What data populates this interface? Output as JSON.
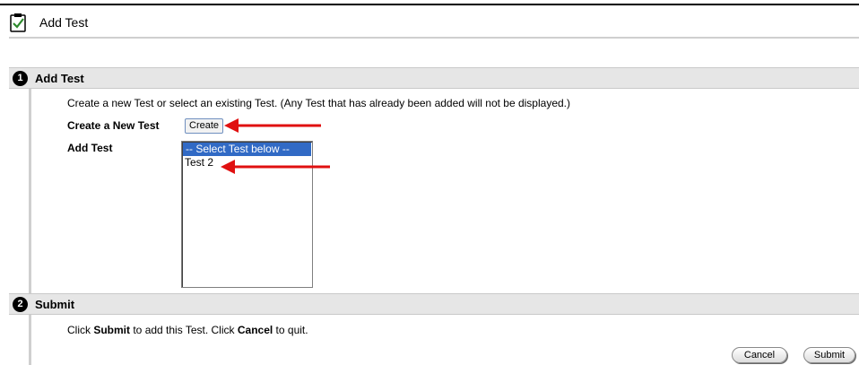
{
  "page": {
    "title": "Add Test",
    "icon": "clipboard-check-icon"
  },
  "section1": {
    "step": "1",
    "title": "Add Test",
    "intro": "Create a new Test or select an existing Test. (Any Test that has already been added will not be displayed.)",
    "create_label": "Create a New Test",
    "create_button": "Create",
    "add_label": "Add Test",
    "options": [
      "-- Select Test below --",
      "Test 2"
    ],
    "selected_option": "-- Select Test below --"
  },
  "section2": {
    "step": "2",
    "title": "Submit",
    "text_parts": [
      "Click ",
      "Submit",
      " to add this Test. Click ",
      "Cancel",
      " to quit."
    ],
    "cancel_button": "Cancel",
    "submit_button": "Submit"
  },
  "colors": {
    "selection": "#316ac5",
    "annotation_arrow": "#e01010",
    "section_bar": "#e6e6e6"
  }
}
